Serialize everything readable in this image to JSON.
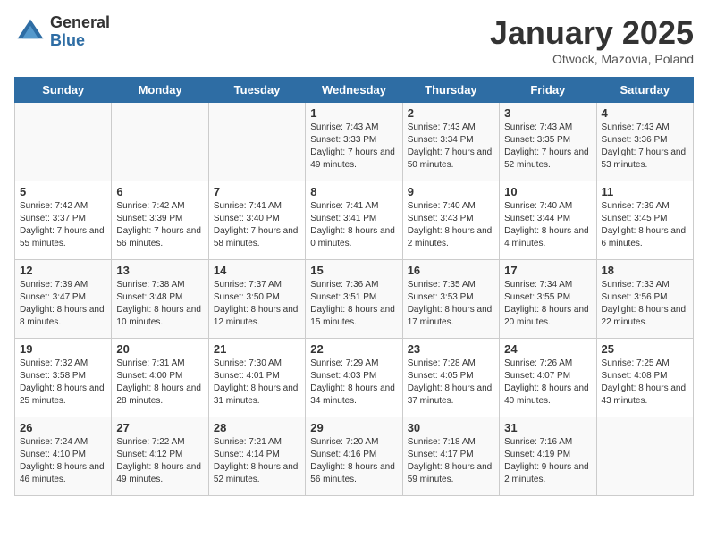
{
  "header": {
    "logo_general": "General",
    "logo_blue": "Blue",
    "title": "January 2025",
    "location": "Otwock, Mazovia, Poland"
  },
  "days_of_week": [
    "Sunday",
    "Monday",
    "Tuesday",
    "Wednesday",
    "Thursday",
    "Friday",
    "Saturday"
  ],
  "weeks": [
    {
      "days": [
        {
          "num": "",
          "info": ""
        },
        {
          "num": "",
          "info": ""
        },
        {
          "num": "",
          "info": ""
        },
        {
          "num": "1",
          "info": "Sunrise: 7:43 AM\nSunset: 3:33 PM\nDaylight: 7 hours\nand 49 minutes."
        },
        {
          "num": "2",
          "info": "Sunrise: 7:43 AM\nSunset: 3:34 PM\nDaylight: 7 hours\nand 50 minutes."
        },
        {
          "num": "3",
          "info": "Sunrise: 7:43 AM\nSunset: 3:35 PM\nDaylight: 7 hours\nand 52 minutes."
        },
        {
          "num": "4",
          "info": "Sunrise: 7:43 AM\nSunset: 3:36 PM\nDaylight: 7 hours\nand 53 minutes."
        }
      ]
    },
    {
      "days": [
        {
          "num": "5",
          "info": "Sunrise: 7:42 AM\nSunset: 3:37 PM\nDaylight: 7 hours\nand 55 minutes."
        },
        {
          "num": "6",
          "info": "Sunrise: 7:42 AM\nSunset: 3:39 PM\nDaylight: 7 hours\nand 56 minutes."
        },
        {
          "num": "7",
          "info": "Sunrise: 7:41 AM\nSunset: 3:40 PM\nDaylight: 7 hours\nand 58 minutes."
        },
        {
          "num": "8",
          "info": "Sunrise: 7:41 AM\nSunset: 3:41 PM\nDaylight: 8 hours\nand 0 minutes."
        },
        {
          "num": "9",
          "info": "Sunrise: 7:40 AM\nSunset: 3:43 PM\nDaylight: 8 hours\nand 2 minutes."
        },
        {
          "num": "10",
          "info": "Sunrise: 7:40 AM\nSunset: 3:44 PM\nDaylight: 8 hours\nand 4 minutes."
        },
        {
          "num": "11",
          "info": "Sunrise: 7:39 AM\nSunset: 3:45 PM\nDaylight: 8 hours\nand 6 minutes."
        }
      ]
    },
    {
      "days": [
        {
          "num": "12",
          "info": "Sunrise: 7:39 AM\nSunset: 3:47 PM\nDaylight: 8 hours\nand 8 minutes."
        },
        {
          "num": "13",
          "info": "Sunrise: 7:38 AM\nSunset: 3:48 PM\nDaylight: 8 hours\nand 10 minutes."
        },
        {
          "num": "14",
          "info": "Sunrise: 7:37 AM\nSunset: 3:50 PM\nDaylight: 8 hours\nand 12 minutes."
        },
        {
          "num": "15",
          "info": "Sunrise: 7:36 AM\nSunset: 3:51 PM\nDaylight: 8 hours\nand 15 minutes."
        },
        {
          "num": "16",
          "info": "Sunrise: 7:35 AM\nSunset: 3:53 PM\nDaylight: 8 hours\nand 17 minutes."
        },
        {
          "num": "17",
          "info": "Sunrise: 7:34 AM\nSunset: 3:55 PM\nDaylight: 8 hours\nand 20 minutes."
        },
        {
          "num": "18",
          "info": "Sunrise: 7:33 AM\nSunset: 3:56 PM\nDaylight: 8 hours\nand 22 minutes."
        }
      ]
    },
    {
      "days": [
        {
          "num": "19",
          "info": "Sunrise: 7:32 AM\nSunset: 3:58 PM\nDaylight: 8 hours\nand 25 minutes."
        },
        {
          "num": "20",
          "info": "Sunrise: 7:31 AM\nSunset: 4:00 PM\nDaylight: 8 hours\nand 28 minutes."
        },
        {
          "num": "21",
          "info": "Sunrise: 7:30 AM\nSunset: 4:01 PM\nDaylight: 8 hours\nand 31 minutes."
        },
        {
          "num": "22",
          "info": "Sunrise: 7:29 AM\nSunset: 4:03 PM\nDaylight: 8 hours\nand 34 minutes."
        },
        {
          "num": "23",
          "info": "Sunrise: 7:28 AM\nSunset: 4:05 PM\nDaylight: 8 hours\nand 37 minutes."
        },
        {
          "num": "24",
          "info": "Sunrise: 7:26 AM\nSunset: 4:07 PM\nDaylight: 8 hours\nand 40 minutes."
        },
        {
          "num": "25",
          "info": "Sunrise: 7:25 AM\nSunset: 4:08 PM\nDaylight: 8 hours\nand 43 minutes."
        }
      ]
    },
    {
      "days": [
        {
          "num": "26",
          "info": "Sunrise: 7:24 AM\nSunset: 4:10 PM\nDaylight: 8 hours\nand 46 minutes."
        },
        {
          "num": "27",
          "info": "Sunrise: 7:22 AM\nSunset: 4:12 PM\nDaylight: 8 hours\nand 49 minutes."
        },
        {
          "num": "28",
          "info": "Sunrise: 7:21 AM\nSunset: 4:14 PM\nDaylight: 8 hours\nand 52 minutes."
        },
        {
          "num": "29",
          "info": "Sunrise: 7:20 AM\nSunset: 4:16 PM\nDaylight: 8 hours\nand 56 minutes."
        },
        {
          "num": "30",
          "info": "Sunrise: 7:18 AM\nSunset: 4:17 PM\nDaylight: 8 hours\nand 59 minutes."
        },
        {
          "num": "31",
          "info": "Sunrise: 7:16 AM\nSunset: 4:19 PM\nDaylight: 9 hours\nand 2 minutes."
        },
        {
          "num": "",
          "info": ""
        }
      ]
    }
  ]
}
